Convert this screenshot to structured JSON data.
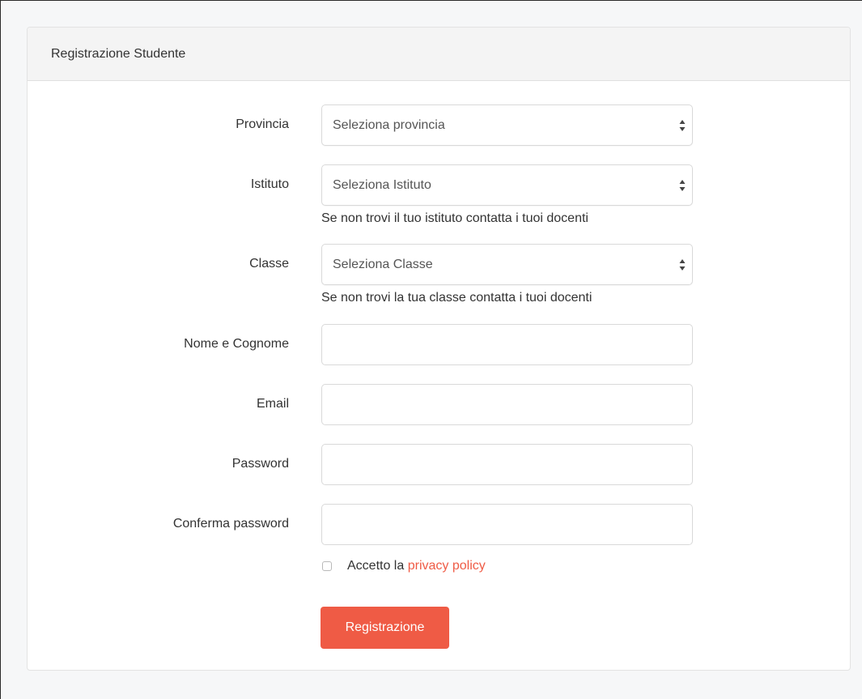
{
  "panel": {
    "title": "Registrazione Studente"
  },
  "form": {
    "provincia": {
      "label": "Provincia",
      "selected": "Seleziona provincia"
    },
    "istituto": {
      "label": "Istituto",
      "selected": "Seleziona Istituto",
      "help": "Se non trovi il tuo istituto contatta i tuoi docenti"
    },
    "classe": {
      "label": "Classe",
      "selected": "Seleziona Classe",
      "help": "Se non trovi la tua classe contatta i tuoi docenti"
    },
    "nome": {
      "label": "Nome e Cognome",
      "value": ""
    },
    "email": {
      "label": "Email",
      "value": ""
    },
    "password": {
      "label": "Password",
      "value": ""
    },
    "conferma": {
      "label": "Conferma password",
      "value": ""
    },
    "privacy": {
      "prefix": "Accetto la",
      "link": "privacy policy",
      "checked": false
    },
    "submit_label": "Registrazione"
  },
  "icons": {
    "select_arrows": "select-arrows-icon"
  },
  "colors": {
    "accent": "#ef5b45",
    "panel_heading_bg": "#f4f4f4",
    "page_bg": "#f6f7f8"
  }
}
